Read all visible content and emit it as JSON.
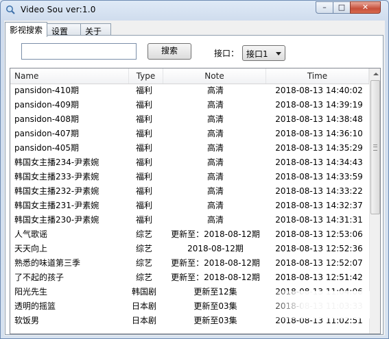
{
  "window": {
    "title": "Video Sou  ver:1.0",
    "controls": {
      "minimize": "–",
      "maximize": "□",
      "close": "✕"
    }
  },
  "tabs": [
    {
      "label": "影视搜索",
      "active": true
    },
    {
      "label": "设置",
      "active": false
    },
    {
      "label": "关于",
      "active": false
    }
  ],
  "search": {
    "value": "",
    "button_label": "搜索"
  },
  "interface": {
    "label": "接口：",
    "selected": "接口1"
  },
  "table": {
    "columns": [
      "Name",
      "Type",
      "Note",
      "Time"
    ],
    "rows": [
      {
        "name": "pansidon-410期",
        "type": "福利",
        "note": "高清",
        "time": "2018-08-13 14:40:02"
      },
      {
        "name": "pansidon-409期",
        "type": "福利",
        "note": "高清",
        "time": "2018-08-13 14:39:19"
      },
      {
        "name": "pansidon-408期",
        "type": "福利",
        "note": "高清",
        "time": "2018-08-13 14:38:48"
      },
      {
        "name": "pansidon-407期",
        "type": "福利",
        "note": "高清",
        "time": "2018-08-13 14:36:10"
      },
      {
        "name": "pansidon-405期",
        "type": "福利",
        "note": "高清",
        "time": "2018-08-13 14:35:29"
      },
      {
        "name": "韩国女主播234-尹素婉",
        "type": "福利",
        "note": "高清",
        "time": "2018-08-13 14:34:43"
      },
      {
        "name": "韩国女主播233-尹素婉",
        "type": "福利",
        "note": "高清",
        "time": "2018-08-13 14:33:59"
      },
      {
        "name": "韩国女主播232-尹素婉",
        "type": "福利",
        "note": "高清",
        "time": "2018-08-13 14:33:22"
      },
      {
        "name": "韩国女主播231-尹素婉",
        "type": "福利",
        "note": "高清",
        "time": "2018-08-13 14:32:37"
      },
      {
        "name": "韩国女主播230-尹素婉",
        "type": "福利",
        "note": "高清",
        "time": "2018-08-13 14:31:31"
      },
      {
        "name": "人气歌谣",
        "type": "综艺",
        "note": "更新至：2018-08-12期",
        "time": "2018-08-13 12:53:06"
      },
      {
        "name": "天天向上",
        "type": "综艺",
        "note": "2018-08-12期",
        "time": "2018-08-13 12:52:36"
      },
      {
        "name": "熟悉的味道第三季",
        "type": "综艺",
        "note": "更新至：2018-08-12期",
        "time": "2018-08-13 12:52:07"
      },
      {
        "name": " 了不起的孩子",
        "type": "综艺",
        "note": "更新至：2018-08-12期",
        "time": "2018-08-13 12:51:42"
      },
      {
        "name": "阳光先生",
        "type": "韩国剧",
        "note": "更新至12集",
        "time": "2018-08-13 11:04:06"
      },
      {
        "name": "透明的摇篮",
        "type": "日本剧",
        "note": "更新至03集",
        "time": "2018-08-13 11:03:33"
      },
      {
        "name": "软饭男",
        "type": "日本剧",
        "note": "更新至03集",
        "time": "2018-08-13 11:02:51"
      }
    ]
  }
}
